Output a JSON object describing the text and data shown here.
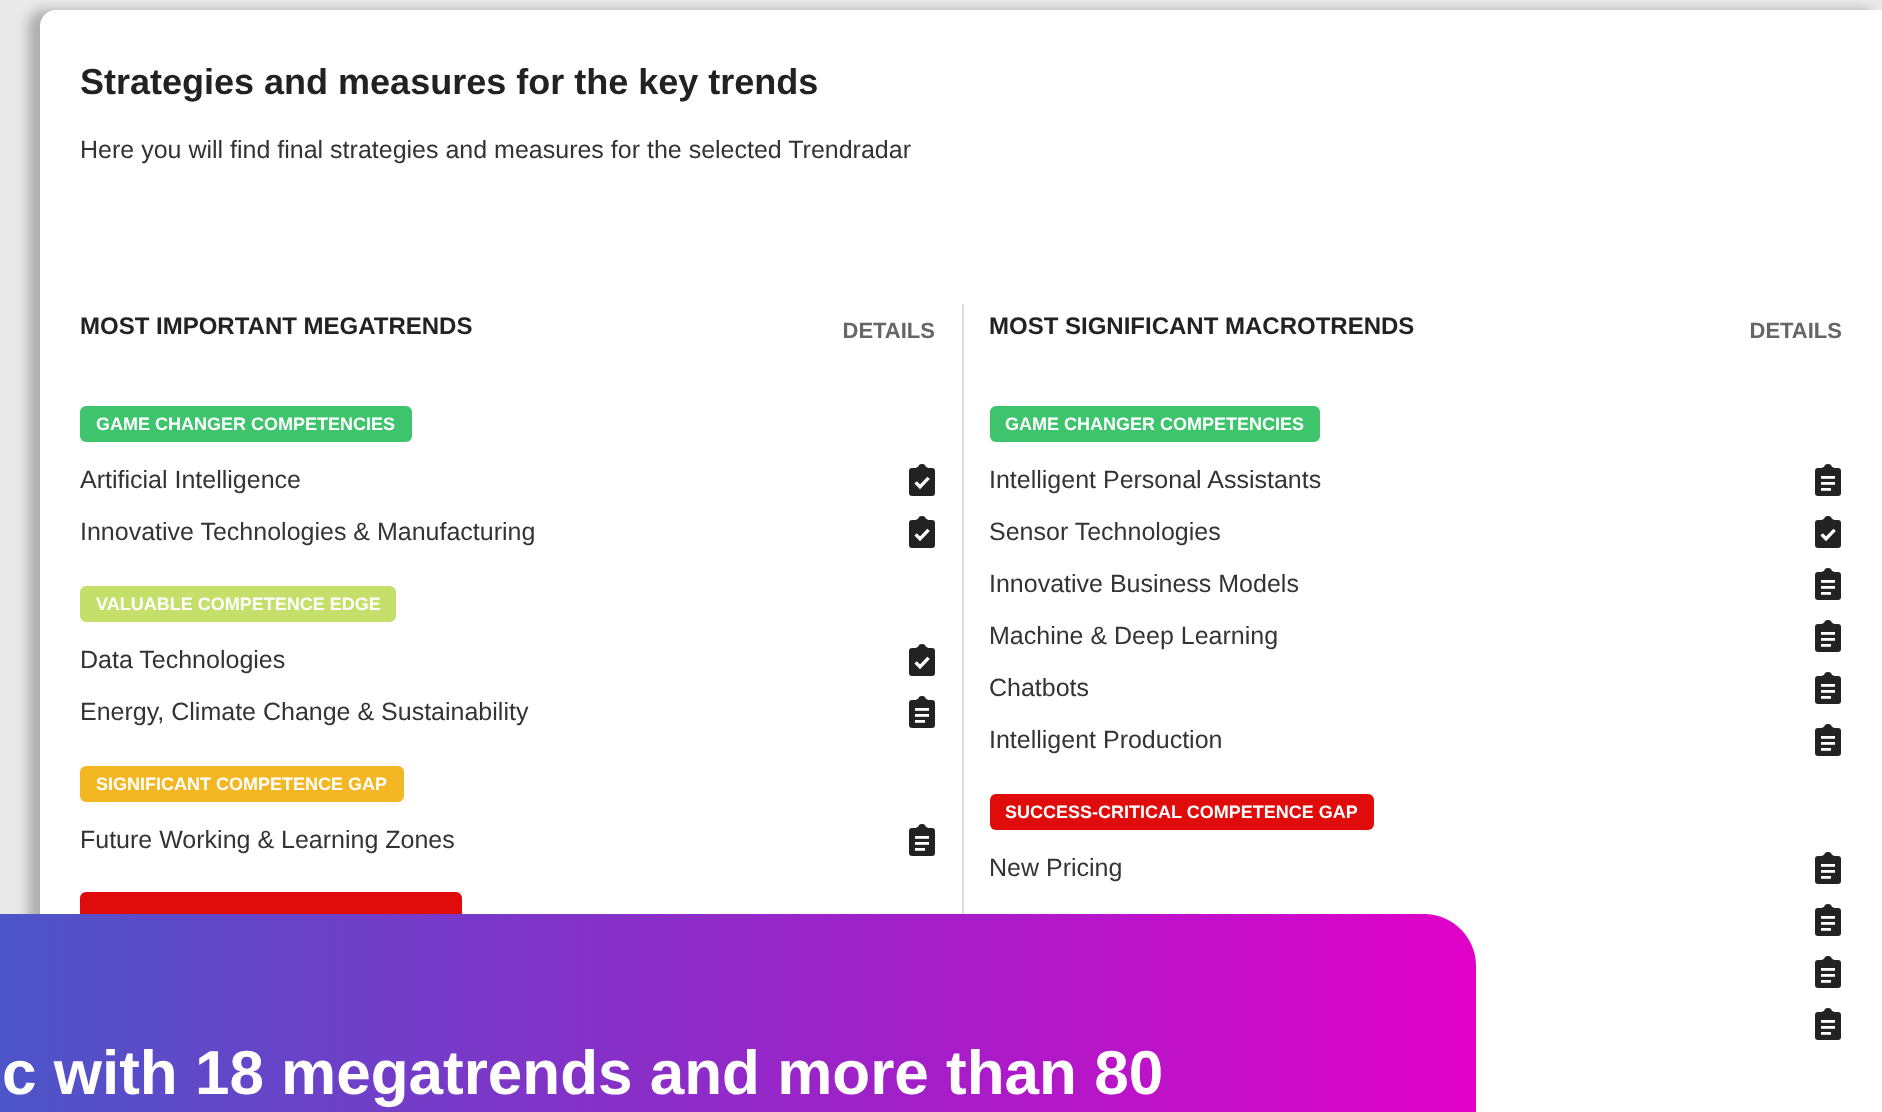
{
  "title": "Strategies and measures for the key trends",
  "subtitle": "Here you will find final strategies and measures for the selected Trendradar",
  "columns": [
    {
      "heading": "MOST IMPORTANT MEGATRENDS",
      "details": "DETAILS",
      "groups": [
        {
          "label": "GAME CHANGER COMPETENCIES",
          "color": "#3ec46d",
          "items": [
            {
              "label": "Artificial Intelligence",
              "done": true
            },
            {
              "label": "Innovative Technologies & Manufacturing",
              "done": true
            }
          ]
        },
        {
          "label": "VALUABLE COMPETENCE EDGE",
          "color": "#c4e06a",
          "items": [
            {
              "label": "Data Technologies",
              "done": true
            },
            {
              "label": "Energy, Climate Change & Sustainability",
              "done": false
            }
          ]
        },
        {
          "label": "SIGNIFICANT COMPETENCE GAP",
          "color": "#f3b724",
          "items": [
            {
              "label": "Future Working & Learning Zones",
              "done": false
            }
          ]
        },
        {
          "color": "#e00b0b"
        }
      ]
    },
    {
      "heading": "MOST SIGNIFICANT MACROTRENDS",
      "details": "DETAILS",
      "groups": [
        {
          "label": "GAME CHANGER COMPETENCIES",
          "color": "#3ec46d",
          "items": [
            {
              "label": "Intelligent Personal Assistants",
              "done": false
            },
            {
              "label": "Sensor Technologies",
              "done": true
            },
            {
              "label": "Innovative Business Models",
              "done": false
            },
            {
              "label": "Machine & Deep Learning",
              "done": false
            },
            {
              "label": "Chatbots",
              "done": false
            },
            {
              "label": "Intelligent Production",
              "done": false
            }
          ]
        },
        {
          "label": "SUCCESS-CRITICAL COMPETENCE GAP",
          "color": "#e00b0b",
          "items": [
            {
              "label": "New Pricing",
              "done": false
            },
            {
              "done": false
            },
            {
              "done": false
            },
            {
              "done": false
            }
          ]
        }
      ]
    }
  ],
  "banner": {
    "text": "c with 18 megatrends and more than 80"
  }
}
